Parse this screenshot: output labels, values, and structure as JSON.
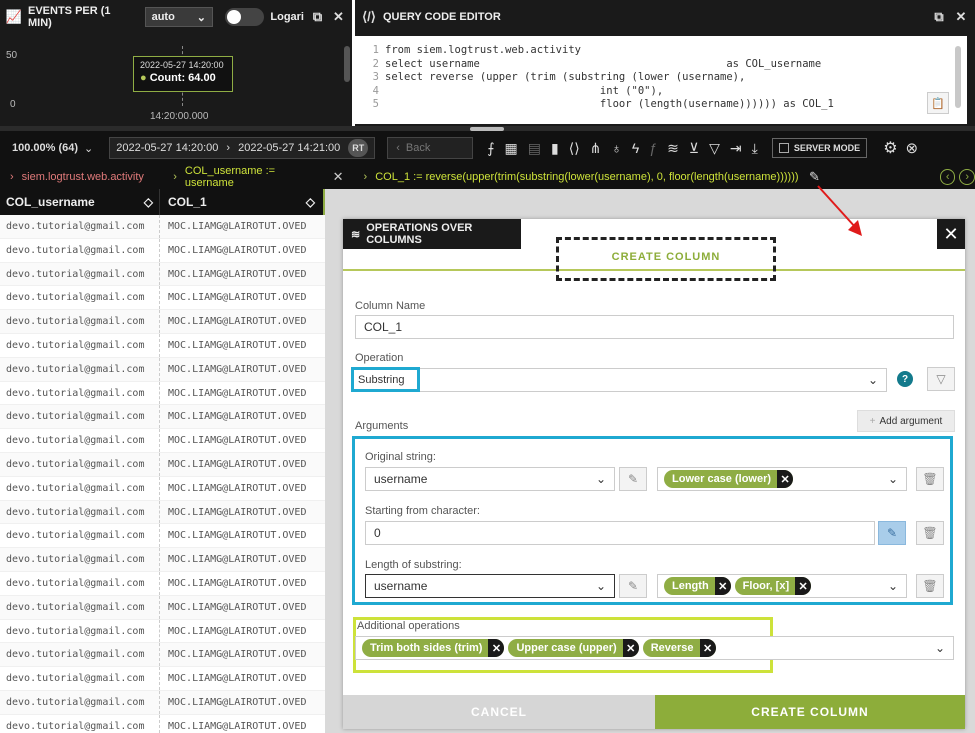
{
  "events": {
    "title": "EVENTS PER (1 MIN)",
    "interval": "auto",
    "toggle_label": "Logari",
    "y_top": "50",
    "y_bottom": "0",
    "tooltip_date": "2022-05-27 14:20:00",
    "tooltip_count": "Count: 64.00",
    "x_label": "14:20:00.000"
  },
  "code": {
    "title": "QUERY CODE EDITOR",
    "lines": [
      {
        "n": "1",
        "t": "from siem.logtrust.web.activity"
      },
      {
        "n": "2",
        "t": "select username                                       as COL_username"
      },
      {
        "n": "3",
        "t": "select reverse (upper (trim (substring (lower (username),"
      },
      {
        "n": "4",
        "t": "                                  int (\"0\"),"
      },
      {
        "n": "5",
        "t": "                                  floor (length(username)))))) as COL_1"
      }
    ]
  },
  "toolbar": {
    "zoom": "100.00% (64)",
    "date_from": "2022-05-27 14:20:00",
    "date_to": "2022-05-27 14:21:00",
    "rt": "RT",
    "back": "Back",
    "server_mode": "SERVER MODE"
  },
  "breadcrumbs": [
    "siem.logtrust.web.activity",
    "COL_username := username",
    "COL_1 := reverse(upper(trim(substring(lower(username), 0, floor(length(username))))))"
  ],
  "table": {
    "headers": [
      "COL_username",
      "COL_1"
    ],
    "rows": [
      [
        "devo.tutorial@gmail.com",
        "MOC.LIAMG@LAIROTUT.OVED"
      ],
      [
        "devo.tutorial@gmail.com",
        "MOC.LIAMG@LAIROTUT.OVED"
      ],
      [
        "devo.tutorial@gmail.com",
        "MOC.LIAMG@LAIROTUT.OVED"
      ],
      [
        "devo.tutorial@gmail.com",
        "MOC.LIAMG@LAIROTUT.OVED"
      ],
      [
        "devo.tutorial@gmail.com",
        "MOC.LIAMG@LAIROTUT.OVED"
      ],
      [
        "devo.tutorial@gmail.com",
        "MOC.LIAMG@LAIROTUT.OVED"
      ],
      [
        "devo.tutorial@gmail.com",
        "MOC.LIAMG@LAIROTUT.OVED"
      ],
      [
        "devo.tutorial@gmail.com",
        "MOC.LIAMG@LAIROTUT.OVED"
      ],
      [
        "devo.tutorial@gmail.com",
        "MOC.LIAMG@LAIROTUT.OVED"
      ],
      [
        "devo.tutorial@gmail.com",
        "MOC.LIAMG@LAIROTUT.OVED"
      ],
      [
        "devo.tutorial@gmail.com",
        "MOC.LIAMG@LAIROTUT.OVED"
      ],
      [
        "devo.tutorial@gmail.com",
        "MOC.LIAMG@LAIROTUT.OVED"
      ],
      [
        "devo.tutorial@gmail.com",
        "MOC.LIAMG@LAIROTUT.OVED"
      ],
      [
        "devo.tutorial@gmail.com",
        "MOC.LIAMG@LAIROTUT.OVED"
      ],
      [
        "devo.tutorial@gmail.com",
        "MOC.LIAMG@LAIROTUT.OVED"
      ],
      [
        "devo.tutorial@gmail.com",
        "MOC.LIAMG@LAIROTUT.OVED"
      ],
      [
        "devo.tutorial@gmail.com",
        "MOC.LIAMG@LAIROTUT.OVED"
      ],
      [
        "devo.tutorial@gmail.com",
        "MOC.LIAMG@LAIROTUT.OVED"
      ],
      [
        "devo.tutorial@gmail.com",
        "MOC.LIAMG@LAIROTUT.OVED"
      ],
      [
        "devo.tutorial@gmail.com",
        "MOC.LIAMG@LAIROTUT.OVED"
      ],
      [
        "devo.tutorial@gmail.com",
        "MOC.LIAMG@LAIROTUT.OVED"
      ],
      [
        "devo.tutorial@gmail.com",
        "MOC.LIAMG@LAIROTUT.OVED"
      ]
    ]
  },
  "modal": {
    "title": "OPERATIONS OVER COLUMNS",
    "tab": "CREATE COLUMN",
    "column_name_label": "Column Name",
    "column_name": "COL_1",
    "operation_label": "Operation",
    "operation": "Substring",
    "arguments_label": "Arguments",
    "add_argument": "Add argument",
    "arg1_label": "Original string:",
    "arg1_value": "username",
    "arg1_chip": "Lower case (lower)",
    "arg2_label": "Starting from character:",
    "arg2_value": "0",
    "arg3_label": "Length of substring:",
    "arg3_value": "username",
    "arg3_chip1": "Length",
    "arg3_chip2": "Floor, [x]",
    "additional_label": "Additional operations",
    "additional": [
      "Trim both sides (trim)",
      "Upper case (upper)",
      "Reverse"
    ],
    "cancel": "CANCEL",
    "create": "CREATE COLUMN"
  },
  "colors": {
    "accent": "#8dad3a",
    "highlight_cyan": "#1fa9d1",
    "highlight_lime": "#cde23a",
    "annotation_red": "#e01b1b"
  }
}
